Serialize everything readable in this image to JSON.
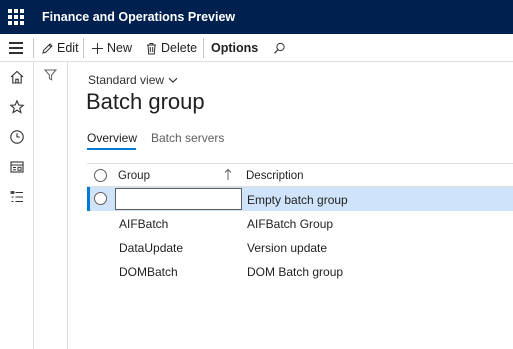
{
  "app": {
    "title": "Finance and Operations Preview"
  },
  "actionpane": {
    "edit_label": "Edit",
    "new_label": "New",
    "delete_label": "Delete",
    "options_label": "Options"
  },
  "navrail": {
    "icons": [
      "home-icon",
      "star-icon",
      "clock-icon",
      "workspace-icon",
      "list-icon"
    ]
  },
  "page": {
    "view_label": "Standard view",
    "title": "Batch group",
    "tabs": [
      {
        "label": "Overview",
        "active": true
      },
      {
        "label": "Batch servers",
        "active": false
      }
    ]
  },
  "grid": {
    "columns": {
      "group": "Group",
      "description": "Description"
    },
    "sort": "ascending",
    "rows": [
      {
        "group": "",
        "description": "Empty batch group",
        "selected": true
      },
      {
        "group": "AIFBatch",
        "description": "AIFBatch Group",
        "selected": false
      },
      {
        "group": "DataUpdate",
        "description": "Version update",
        "selected": false
      },
      {
        "group": "DOMBatch",
        "description": "DOM Batch group",
        "selected": false
      }
    ]
  },
  "colors": {
    "topbar": "#002050",
    "accent": "#0078d4",
    "selected_row": "#cfe4fa"
  }
}
